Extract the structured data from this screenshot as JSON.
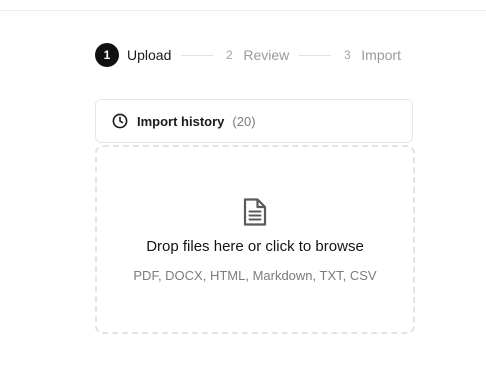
{
  "stepper": {
    "steps": [
      {
        "number": "1",
        "label": "Upload"
      },
      {
        "number": "2",
        "label": "Review"
      },
      {
        "number": "3",
        "label": "Import"
      }
    ],
    "active_step": 1
  },
  "history": {
    "label": "Import history",
    "count": "(20)",
    "icon": "clock-icon"
  },
  "dropzone": {
    "icon": "document-icon",
    "title": "Drop files here or click to browse",
    "subtitle": "PDF, DOCX, HTML, Markdown, TXT, CSV"
  }
}
